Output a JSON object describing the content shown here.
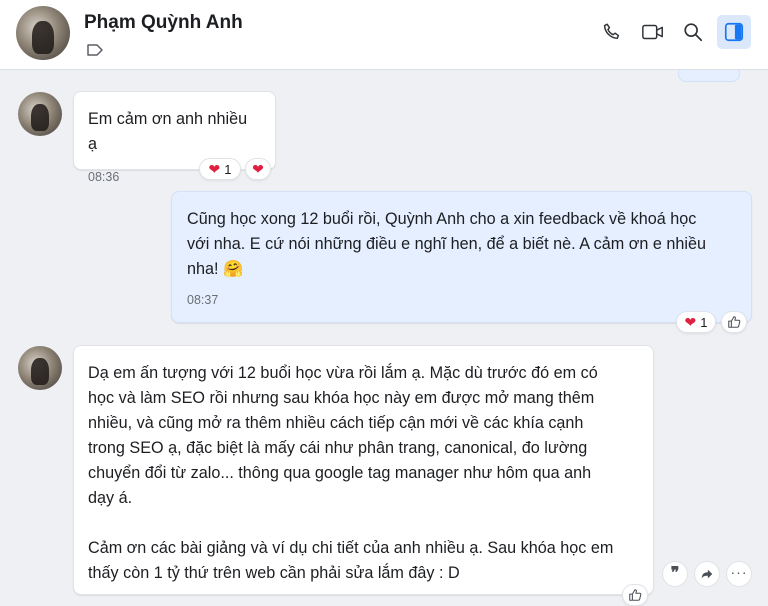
{
  "contact": {
    "name": "Phạm Quỳnh Anh"
  },
  "messages": [
    {
      "id": "m1",
      "text": "Em cảm ơn anh nhiều ạ",
      "time": "08:36",
      "reaction_count": "1"
    },
    {
      "id": "m2",
      "lines": [
        "Cũng học xong 12 buổi rồi, Quỳnh Anh cho a xin feedback về khoá học",
        "với nha. E cứ nói những điều e nghĩ hen, để a biết nè. A cảm ơn e nhiều",
        "nha! 🤗"
      ],
      "time": "08:37",
      "reaction_count": "1"
    },
    {
      "id": "m3",
      "paragraph1": [
        "Dạ em ấn tượng với 12 buổi học vừa rồi lắm ạ. Mặc dù trước đó em có",
        "học và làm SEO rồi nhưng sau khóa học này em được mở mang thêm",
        "nhiều, và cũng mở ra thêm nhiều cách tiếp cận mới về các khía cạnh",
        "trong SEO ạ, đặc biệt là mấy cái như phân trang, canonical, đo lường",
        "chuyển đổi từ zalo... thông qua google tag manager như hôm qua anh",
        "dạy á."
      ],
      "paragraph2": [
        "Cảm ơn các bài giảng và ví dụ chi tiết của anh nhiều ạ. Sau khóa học em",
        "thấy còn 1 tỷ thứ trên web cần phải sửa lắm đây : D"
      ]
    }
  ],
  "colors": {
    "accent": "#1877f2",
    "outgoing_bubble": "#e5efff",
    "heart": "#e02040"
  }
}
